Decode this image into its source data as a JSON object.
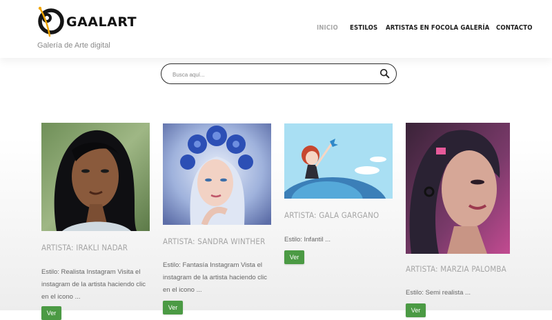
{
  "brand": {
    "name": "GAALART",
    "tagline": "Galería de Arte digital",
    "accent": "#f0a500"
  },
  "nav": [
    "INICIO",
    "ESTILOS",
    "ARTISTAS EN FOCO",
    "LA GALERÍA",
    "CONTACTO"
  ],
  "search": {
    "placeholder": "Busca aquí..."
  },
  "cards": [
    {
      "title": "ARTISTA: IRAKLI NADAR",
      "desc": "Estilo: Realista Instagram Visita el instagram de la artista haciendo clic en el icono ...",
      "button": "Ver"
    },
    {
      "title": "ARTISTA: SANDRA WINTHER",
      "desc": "Estilo: Fantasía Instagram Vista el instagram de la artista haciendo clic en el icono ...",
      "button": "Ver"
    },
    {
      "title": "ARTISTA: GALA GARGANO",
      "desc": "Estilo: Infantil ...",
      "button": "Ver"
    },
    {
      "title": "ARTISTA: MARZIA PALOMBA",
      "desc": "Estilo: Semi realista ...",
      "button": "Ver"
    }
  ],
  "colors": {
    "button": "#4b9a44",
    "nav_active": "#a9a9a9",
    "title_gray": "#a5a5a5"
  }
}
